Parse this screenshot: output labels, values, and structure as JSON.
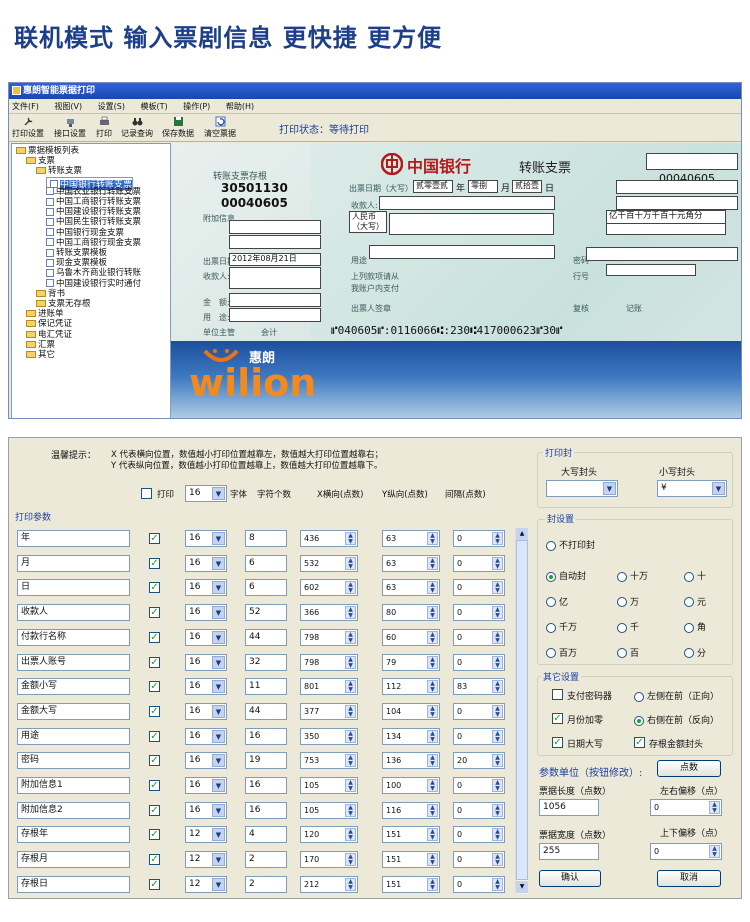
{
  "headline": "联机模式  输入票剧信息 更快捷  更方便",
  "window": {
    "title": "惠朗智能票据打印"
  },
  "menu": [
    "文件(F)",
    "视图(V)",
    "设置(S)",
    "模板(T)",
    "操作(P)",
    "帮助(H)"
  ],
  "toolbar": {
    "buttons": [
      "打印设置",
      "接口设置",
      "打印",
      "记录查询",
      "保存数据",
      "清空票据"
    ],
    "status": "打印状态：等待打印"
  },
  "tree": [
    {
      "label": "票据模板列表",
      "lv": 0,
      "k": "f"
    },
    {
      "label": "支票",
      "lv": 1,
      "k": "f"
    },
    {
      "label": "转账支票",
      "lv": 2,
      "k": "f"
    },
    {
      "label": "中国银行转账支票",
      "lv": 3,
      "k": "d",
      "sel": true
    },
    {
      "label": "中国农业银行转账支票",
      "lv": 3,
      "k": "d"
    },
    {
      "label": "中国工商银行转账支票",
      "lv": 3,
      "k": "d"
    },
    {
      "label": "中国建设银行转账支票",
      "lv": 3,
      "k": "d"
    },
    {
      "label": "中国民生银行转账支票",
      "lv": 3,
      "k": "d"
    },
    {
      "label": "中国银行现金支票",
      "lv": 3,
      "k": "d"
    },
    {
      "label": "中国工商银行现金支票",
      "lv": 3,
      "k": "d"
    },
    {
      "label": "转账支票模板",
      "lv": 3,
      "k": "d"
    },
    {
      "label": "现金支票模板",
      "lv": 3,
      "k": "d"
    },
    {
      "label": "乌鲁木齐商业银行转账",
      "lv": 3,
      "k": "d"
    },
    {
      "label": "中国建设银行实时通付",
      "lv": 3,
      "k": "d"
    },
    {
      "label": "背书",
      "lv": 2,
      "k": "f"
    },
    {
      "label": "支票无存根",
      "lv": 2,
      "k": "f"
    },
    {
      "label": "进账单",
      "lv": 1,
      "k": "f"
    },
    {
      "label": "保记凭证",
      "lv": 1,
      "k": "f"
    },
    {
      "label": "电汇凭证",
      "lv": 1,
      "k": "f"
    },
    {
      "label": "汇票",
      "lv": 1,
      "k": "f"
    },
    {
      "label": "其它",
      "lv": 1,
      "k": "f"
    }
  ],
  "cheque": {
    "stub_title": "转账支票存根",
    "stub_no1": "30501130",
    "stub_no2": "00040605",
    "stub_extra": "附加信息",
    "stub_date_label": "出票日期",
    "stub_date": "2012年08月21日",
    "stub_payee_label": "收款人:",
    "stub_amount_label": "金　额:",
    "stub_use_label": "用　途:",
    "stub_mgr": "单位主管",
    "stub_acc": "会计",
    "bank_name": "中国银行",
    "title": "转账支票",
    "serial": "00040605",
    "date_label": "出票日期（大写）",
    "date_year": "贰零壹贰",
    "y": "年",
    "date_month": "零捌",
    "m": "月",
    "date_day": "贰拾壹",
    "d": "日",
    "payee_label": "收款人:",
    "rmb_label": "人民币（大写）",
    "digits": "亿千百十万千百十元角分",
    "use_label": "用途",
    "pwd_label": "密码",
    "line1": "上列款项请从",
    "line2": "我账户内支付",
    "drawer_sign": "出票人签章",
    "row_no": "行号",
    "review": "复核",
    "bookkeep": "记账",
    "micr": "⑈040605⑈:0116066⑆:230⑆417000623⑈30⑈",
    "brand_cn": "惠朗",
    "brand_en": "wilion"
  },
  "tips": {
    "label": "温馨提示：",
    "l1": "X 代表横向位置，数值越小打印位置越靠左，数值越大打印位置越靠右；",
    "l2": "Y 代表纵向位置，数值越小打印位置越靠上，数值越大打印位置越靠下。"
  },
  "header": {
    "print": "打印",
    "font_size": "16",
    "font": "字体",
    "chars": "字符个数",
    "x": "X横向(点数)",
    "y": "Y纵向(点数)",
    "gap": "间隔(点数)"
  },
  "param_title": "打印参数",
  "rows": [
    {
      "name": "年",
      "fs": "16",
      "n": "8",
      "x": "436",
      "y": "63",
      "g": "0"
    },
    {
      "name": "月",
      "fs": "16",
      "n": "6",
      "x": "532",
      "y": "63",
      "g": "0"
    },
    {
      "name": "日",
      "fs": "16",
      "n": "6",
      "x": "602",
      "y": "63",
      "g": "0"
    },
    {
      "name": "收款人",
      "fs": "16",
      "n": "52",
      "x": "366",
      "y": "80",
      "g": "0"
    },
    {
      "name": "付款行名称",
      "fs": "16",
      "n": "44",
      "x": "798",
      "y": "60",
      "g": "0"
    },
    {
      "name": "出票人账号",
      "fs": "16",
      "n": "32",
      "x": "798",
      "y": "79",
      "g": "0"
    },
    {
      "name": "金额小写",
      "fs": "16",
      "n": "11",
      "x": "801",
      "y": "112",
      "g": "83"
    },
    {
      "name": "金额大写",
      "fs": "16",
      "n": "44",
      "x": "377",
      "y": "104",
      "g": "0"
    },
    {
      "name": "用途",
      "fs": "16",
      "n": "16",
      "x": "350",
      "y": "134",
      "g": "0"
    },
    {
      "name": "密码",
      "fs": "16",
      "n": "19",
      "x": "753",
      "y": "136",
      "g": "20"
    },
    {
      "name": "附加信息1",
      "fs": "16",
      "n": "16",
      "x": "105",
      "y": "100",
      "g": "0"
    },
    {
      "name": "附加信息2",
      "fs": "16",
      "n": "16",
      "x": "105",
      "y": "116",
      "g": "0"
    },
    {
      "name": "存根年",
      "fs": "12",
      "n": "4",
      "x": "120",
      "y": "151",
      "g": "0"
    },
    {
      "name": "存根月",
      "fs": "12",
      "n": "2",
      "x": "170",
      "y": "151",
      "g": "0"
    },
    {
      "name": "存根日",
      "fs": "12",
      "n": "2",
      "x": "212",
      "y": "151",
      "g": "0"
    }
  ],
  "seal": {
    "title": "打印封",
    "big_label": "大写封头",
    "big_value": "",
    "small_label": "小写封头",
    "small_value": "¥"
  },
  "seal_set": {
    "title": "封设置",
    "no_print": "不打印封",
    "options": [
      "自动封",
      "十万",
      "十",
      "亿",
      "万",
      "元",
      "千万",
      "千",
      "角",
      "百万",
      "百",
      "分"
    ]
  },
  "other": {
    "title": "其它设置",
    "pay_pwd": "支付密码器",
    "left_first": "左侧在前（正向）",
    "month_zero": "月份加零",
    "right_first": "右侧在前（反向）",
    "date_upper": "日期大写",
    "stub_amount": "存根金额封头"
  },
  "units": {
    "title": "参数单位（按钮修改）:",
    "btn": "点数",
    "len_label": "票据长度（点数）",
    "len": "1056",
    "left_label": "左右偏移（点）",
    "left": "0",
    "wid_label": "票据宽度（点数）",
    "wid": "255",
    "top_label": "上下偏移（点）",
    "top": "0"
  },
  "ok": "确认",
  "cancel": "取消",
  "colors": {
    "accent": "#1a3fa0",
    "title": "#1d3f8a"
  }
}
